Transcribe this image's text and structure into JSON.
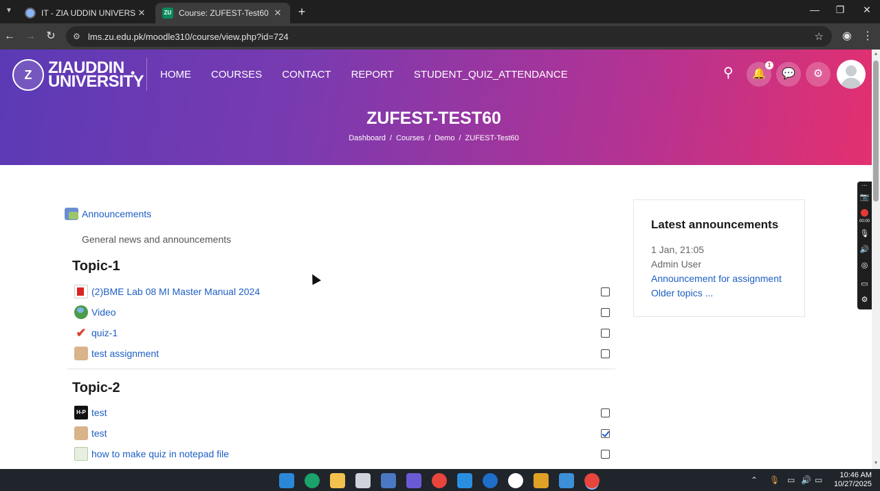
{
  "browser": {
    "tabs": [
      {
        "title": "IT - ZIA UDDIN UNIVERSITY",
        "active": false
      },
      {
        "title": "Course: ZUFEST-Test60",
        "active": true,
        "favicon_text": "ZU"
      }
    ],
    "url": "lms.zu.edu.pk/moodle310/course/view.php?id=724"
  },
  "header": {
    "logo_seal": "Z",
    "logo_line1": "ZIAUDDIN",
    "logo_line2": "UNIVERSITY",
    "nav": [
      "HOME",
      "COURSES",
      "CONTACT",
      "REPORT",
      "STUDENT_QUIZ_ATTENDANCE"
    ],
    "notification_count": "1",
    "page_title": "ZUFEST-TEST60",
    "breadcrumb": [
      "Dashboard",
      "Courses",
      "Demo",
      "ZUFEST-Test60"
    ]
  },
  "course": {
    "announcements": {
      "label": "Announcements",
      "description": "General news and announcements"
    },
    "topics": [
      {
        "title": "Topic-1",
        "activities": [
          {
            "name": "(2)BME Lab 08 MI Master Manual 2024",
            "icon": "pdf-icon",
            "done": false
          },
          {
            "name": "Video",
            "icon": "url-icon",
            "done": false
          },
          {
            "name": "quiz-1",
            "icon": "quiz-icon",
            "done": false
          },
          {
            "name": "test assignment",
            "icon": "assignment-icon",
            "done": false
          }
        ]
      },
      {
        "title": "Topic-2",
        "activities": [
          {
            "name": "test",
            "icon": "h5p-icon",
            "done": false,
            "icon_text": "H-P"
          },
          {
            "name": "test",
            "icon": "assignment-icon",
            "done": true
          },
          {
            "name": "how to make quiz in notepad file",
            "icon": "page-icon",
            "done": false
          }
        ]
      }
    ]
  },
  "latest_announcements": {
    "title": "Latest announcements",
    "date": "1 Jan, 21:05",
    "author": "Admin User",
    "link": "Announcement for assignment",
    "older": "Older topics ..."
  },
  "recorder": {
    "time": "00:00"
  },
  "taskbar": {
    "time": "10:46 AM",
    "date": "10/27/2025"
  },
  "colors": {
    "link": "#1d5ec4",
    "hero_start": "#5b3ab6",
    "hero_end": "#e3306f"
  }
}
